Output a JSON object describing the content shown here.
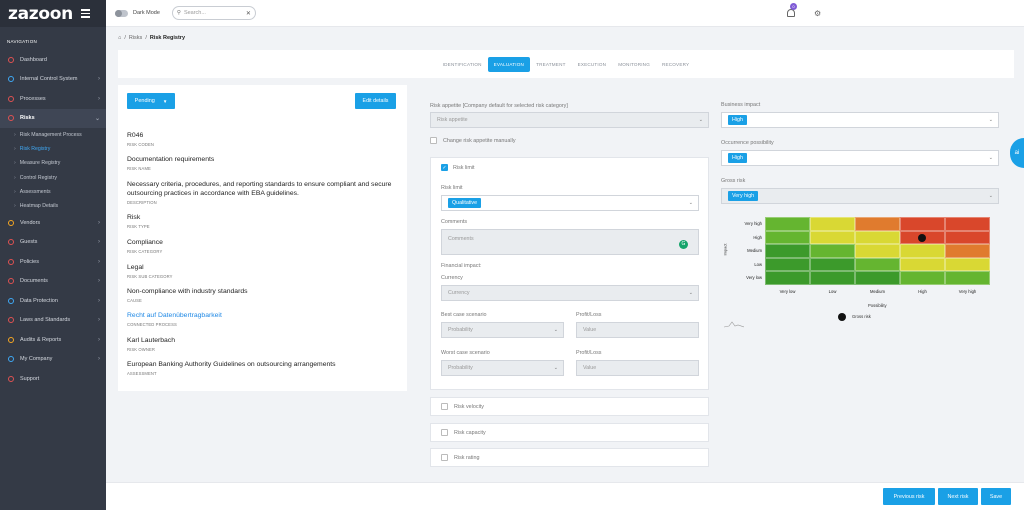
{
  "app": {
    "logo": "zazoon"
  },
  "sidebar": {
    "title": "NAVIGATION",
    "items": [
      {
        "label": "Dashboard",
        "icon": "dashboard-icon",
        "color": "#e05252",
        "chev": ""
      },
      {
        "label": "Internal Control System",
        "icon": "control-icon",
        "color": "#3fa9f5",
        "chev": "›"
      },
      {
        "label": "Processes",
        "icon": "process-icon",
        "color": "#e05252",
        "chev": "›"
      },
      {
        "label": "Risks",
        "icon": "risk-icon",
        "color": "#e05252",
        "chev": "⌄"
      }
    ],
    "subitems": [
      {
        "label": "Risk Management Process"
      },
      {
        "label": "Risk Registry"
      },
      {
        "label": "Measure Registry"
      },
      {
        "label": "Control Registry"
      },
      {
        "label": "Assessments"
      },
      {
        "label": "Heatmap Details"
      }
    ],
    "items2": [
      {
        "label": "Vendors",
        "icon": "vendor-icon",
        "color": "#f5a623",
        "chev": "›"
      },
      {
        "label": "Guests",
        "icon": "guest-icon",
        "color": "#e05252",
        "chev": "›"
      },
      {
        "label": "Policies",
        "icon": "policy-icon",
        "color": "#e05252",
        "chev": "›"
      },
      {
        "label": "Documents",
        "icon": "document-icon",
        "color": "#e05252",
        "chev": "›"
      },
      {
        "label": "Data Protection",
        "icon": "shield-icon",
        "color": "#3fa9f5",
        "chev": "›"
      },
      {
        "label": "Laws and Standards",
        "icon": "law-icon",
        "color": "#e05252",
        "chev": "›"
      },
      {
        "label": "Audits & Reports",
        "icon": "audit-icon",
        "color": "#f5a623",
        "chev": "›"
      },
      {
        "label": "My Company",
        "icon": "company-icon",
        "color": "#3fa9f5",
        "chev": "›"
      },
      {
        "label": "Support",
        "icon": "support-icon",
        "color": "#e05252",
        "chev": ""
      }
    ]
  },
  "topbar": {
    "dark_mode": "Dark Mode",
    "search_placeholder": "Search...",
    "notif_count": "0"
  },
  "breadcrumb": {
    "home": "⌂",
    "sep": "/",
    "level1": "Risks",
    "current": "Risk Registry"
  },
  "tabs": [
    "IDENTIFICATION",
    "EVALUATION",
    "TREATMENT",
    "EXECUTION",
    "MONITORING",
    "RECOVERY"
  ],
  "left": {
    "status": "Pending",
    "edit": "Edit details",
    "fields": [
      {
        "value": "R046",
        "label": "RISK CODEN"
      },
      {
        "value": "Documentation requirements",
        "label": "RISK NAME"
      },
      {
        "value": "Necessary criteria, procedures, and reporting standards to ensure compliant and secure outsourcing practices in accordance with EBA guidelines.",
        "label": "DESCRIPTION"
      },
      {
        "value": "Risk",
        "label": "RISK TYPE"
      },
      {
        "value": "Compliance",
        "label": "RISK CATEGORY"
      },
      {
        "value": "Legal",
        "label": "RISK SUB CATEGORY"
      },
      {
        "value": "Non-compliance with industry standards",
        "label": "CAUSE"
      },
      {
        "value": "Recht auf Datenübertragbarkeit",
        "label": "CONNECTED PROCESS"
      },
      {
        "value": "Karl Lauterbach",
        "label": "RISK OWNER"
      },
      {
        "value": "European Banking Authority Guidelines on outsourcing arrangements",
        "label": "ASSESSMENT"
      }
    ]
  },
  "middle": {
    "appetite_label": "Risk appetite [Company default for selected risk category]",
    "appetite_placeholder": "Risk appetite",
    "change_manual": "Change risk appetite manually",
    "risk_limit": "Risk limit",
    "risk_limit_label": "Risk limit",
    "risk_limit_value": "Qualitative",
    "comments_label": "Comments",
    "comments_placeholder": "Comments",
    "financial_impact": "Financial impact:",
    "currency_label": "Currency",
    "currency_placeholder": "Currency",
    "best_case": "Best case scenario",
    "worst_case": "Worst case scenario",
    "profit_loss": "Profit/Loss",
    "probability": "Probability",
    "value": "Value",
    "velocity": "Risk velocity",
    "capacity": "Risk capacity",
    "rating": "Risk rating"
  },
  "right": {
    "business_impact_label": "Business impact",
    "business_impact": "High",
    "occurrence_label": "Occurrence possibility",
    "occurrence": "High",
    "gross_label": "Gross risk",
    "gross": "Very high"
  },
  "heatmap": {
    "y_labels": [
      "Very high",
      "High",
      "Medium",
      "Low",
      "Very low"
    ],
    "x_labels": [
      "Very low",
      "Low",
      "Medium",
      "High",
      "Very high"
    ],
    "y_title": "Impact",
    "x_title": "Possibility",
    "legend": "Gross risk",
    "colors": [
      [
        "#65b530",
        "#d9d834",
        "#e07b2e",
        "#d9472b",
        "#d9472b"
      ],
      [
        "#65b530",
        "#d9d834",
        "#d9d834",
        "#d9472b",
        "#d9472b"
      ],
      [
        "#3c9a2b",
        "#65b530",
        "#d9d834",
        "#d9d834",
        "#e07b2e"
      ],
      [
        "#3c9a2b",
        "#3c9a2b",
        "#65b530",
        "#d9d834",
        "#d9d834"
      ],
      [
        "#3c9a2b",
        "#3c9a2b",
        "#3c9a2b",
        "#65b530",
        "#65b530"
      ]
    ],
    "marker": {
      "impact": "High",
      "possibility": "High"
    }
  },
  "footer": {
    "previous": "Previous risk",
    "next": "Next risk",
    "save": "Save"
  },
  "ai_button": "ai"
}
